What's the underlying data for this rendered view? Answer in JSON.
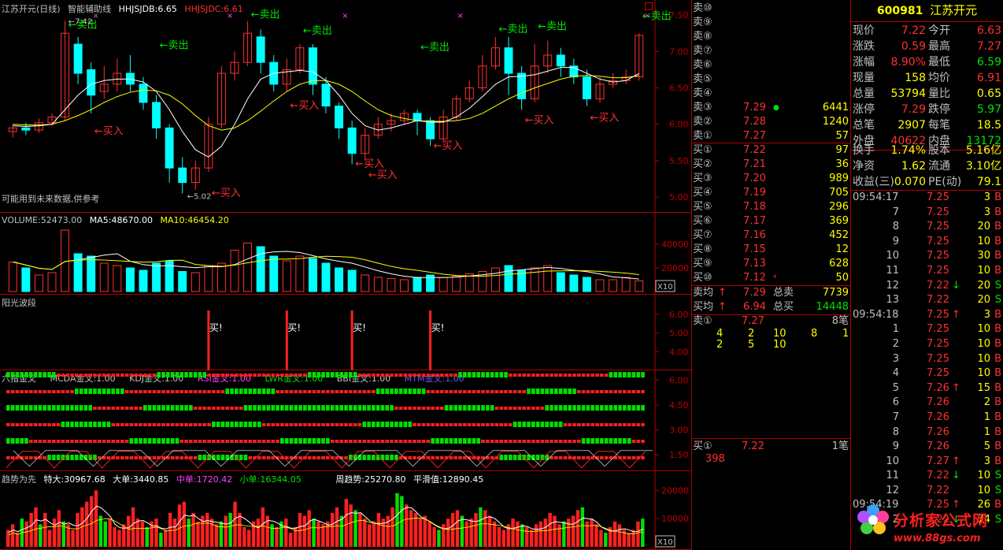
{
  "price_chart": {
    "title_name": "江苏开元(日线)",
    "title_indicator": "智能辅助线",
    "hhjsjdb_label": "HHJSJDB:6.65",
    "hhjsjdc_label": "HHJSJDC:6.61",
    "axis_labels": [
      "7.50",
      "7.00",
      "6.50",
      "6.00",
      "5.50",
      "5.00"
    ],
    "axis_values": [
      7.5,
      7.0,
      6.5,
      6.0,
      5.5,
      5.0
    ],
    "high_label": "7.42",
    "low_label": "5.02",
    "warning": "可能用到未来数据,供参考",
    "sell_label": "卖出",
    "buy_label": "买入",
    "sell_points": [
      {
        "i": 4,
        "p": 7.28
      },
      {
        "i": 11,
        "p": 7.0
      },
      {
        "i": 18,
        "p": 7.42
      },
      {
        "i": 22,
        "p": 7.2
      },
      {
        "i": 31,
        "p": 6.97
      },
      {
        "i": 37,
        "p": 7.22
      },
      {
        "i": 40,
        "p": 7.26
      },
      {
        "i": 48,
        "p": 7.4
      }
    ],
    "buy_points": [
      {
        "i": 6,
        "p": 5.95
      },
      {
        "i": 15,
        "p": 5.1
      },
      {
        "i": 21,
        "p": 6.3
      },
      {
        "i": 26,
        "p": 5.5
      },
      {
        "i": 27,
        "p": 5.35
      },
      {
        "i": 32,
        "p": 5.75
      },
      {
        "i": 39,
        "p": 6.1
      },
      {
        "i": 44,
        "p": 6.13
      }
    ],
    "candles": [
      [
        5.9,
        5.95,
        5.82,
        6.0
      ],
      [
        5.95,
        5.92,
        5.85,
        6.02
      ],
      [
        5.92,
        6.02,
        5.88,
        6.08
      ],
      [
        6.02,
        6.1,
        5.98,
        6.15
      ],
      [
        6.1,
        7.25,
        6.05,
        7.42
      ],
      [
        7.1,
        6.7,
        6.55,
        7.2
      ],
      [
        6.75,
        6.4,
        6.15,
        6.85
      ],
      [
        6.45,
        6.55,
        6.35,
        6.8
      ],
      [
        6.55,
        6.7,
        6.45,
        6.9
      ],
      [
        6.7,
        6.55,
        6.45,
        6.95
      ],
      [
        6.55,
        6.3,
        6.2,
        6.65
      ],
      [
        6.3,
        5.95,
        5.8,
        6.4
      ],
      [
        5.95,
        5.4,
        5.2,
        6.0
      ],
      [
        5.4,
        5.2,
        5.05,
        5.55
      ],
      [
        5.2,
        5.4,
        5.1,
        5.5
      ],
      [
        5.4,
        6.0,
        5.35,
        6.1
      ],
      [
        6.0,
        6.7,
        5.95,
        6.8
      ],
      [
        6.7,
        6.85,
        6.6,
        7.0
      ],
      [
        6.85,
        7.25,
        6.8,
        7.42
      ],
      [
        7.2,
        6.85,
        6.7,
        7.3
      ],
      [
        6.85,
        6.55,
        6.45,
        6.95
      ],
      [
        6.55,
        6.75,
        6.45,
        6.9
      ],
      [
        6.75,
        7.05,
        6.7,
        7.1
      ],
      [
        7.05,
        6.55,
        6.4,
        7.1
      ],
      [
        6.55,
        6.25,
        6.15,
        6.65
      ],
      [
        6.25,
        5.95,
        5.8,
        6.3
      ],
      [
        5.95,
        5.6,
        5.45,
        6.05
      ],
      [
        5.6,
        5.85,
        5.5,
        5.95
      ],
      [
        5.85,
        6.0,
        5.8,
        6.1
      ],
      [
        6.0,
        6.05,
        5.9,
        6.15
      ],
      [
        6.05,
        6.15,
        6.0,
        6.2
      ],
      [
        6.15,
        6.05,
        5.85,
        6.2
      ],
      [
        6.05,
        5.8,
        5.7,
        6.1
      ],
      [
        5.8,
        6.1,
        5.75,
        6.2
      ],
      [
        6.1,
        6.35,
        6.05,
        6.4
      ],
      [
        6.35,
        6.5,
        6.3,
        6.6
      ],
      [
        6.5,
        6.8,
        6.45,
        6.95
      ],
      [
        6.8,
        7.05,
        6.75,
        7.2
      ],
      [
        7.05,
        6.7,
        6.4,
        7.2
      ],
      [
        6.7,
        6.35,
        6.2,
        6.8
      ],
      [
        6.35,
        6.8,
        6.3,
        7.1
      ],
      [
        6.8,
        6.95,
        6.7,
        7.15
      ],
      [
        6.95,
        6.8,
        6.65,
        7.05
      ],
      [
        6.8,
        6.65,
        6.55,
        6.9
      ],
      [
        6.65,
        6.35,
        6.25,
        6.75
      ],
      [
        6.35,
        6.55,
        6.3,
        6.65
      ],
      [
        6.55,
        6.6,
        6.5,
        6.7
      ],
      [
        6.6,
        6.65,
        6.55,
        6.75
      ],
      [
        6.65,
        7.22,
        6.6,
        7.25
      ]
    ],
    "ma_short": [
      5.98,
      5.97,
      5.98,
      6.0,
      6.2,
      6.4,
      6.55,
      6.6,
      6.62,
      6.62,
      6.58,
      6.45,
      6.2,
      5.9,
      5.65,
      5.55,
      5.7,
      6.0,
      6.35,
      6.62,
      6.7,
      6.72,
      6.74,
      6.72,
      6.6,
      6.4,
      6.15,
      5.98,
      5.92,
      5.95,
      6.0,
      6.05,
      6.03,
      6.03,
      6.1,
      6.22,
      6.38,
      6.55,
      6.65,
      6.66,
      6.68,
      6.73,
      6.78,
      6.78,
      6.7,
      6.62,
      6.58,
      6.6,
      6.7
    ],
    "ma_long": [
      6.0,
      5.99,
      5.99,
      6.0,
      6.05,
      6.12,
      6.2,
      6.3,
      6.38,
      6.44,
      6.47,
      6.46,
      6.4,
      6.28,
      6.12,
      5.98,
      5.92,
      5.95,
      6.05,
      6.18,
      6.32,
      6.45,
      6.55,
      6.6,
      6.6,
      6.55,
      6.45,
      6.32,
      6.2,
      6.12,
      6.08,
      6.05,
      6.04,
      6.04,
      6.05,
      6.08,
      6.15,
      6.25,
      6.35,
      6.43,
      6.5,
      6.56,
      6.62,
      6.66,
      6.67,
      6.66,
      6.64,
      6.64,
      6.67
    ]
  },
  "volume_panel": {
    "label_volume": "VOLUME:52473.00",
    "label_ma5": "MA5:48670.00",
    "label_ma10": "MA10:46454.20",
    "axis_labels": [
      "40000",
      "20000"
    ],
    "axis_values": [
      40000,
      20000
    ],
    "max": 52000,
    "x10": "X10",
    "values": [
      25000,
      20000,
      14000,
      16000,
      52000,
      32000,
      30000,
      24000,
      22000,
      20000,
      18000,
      24000,
      26000,
      17000,
      16000,
      22000,
      24000,
      35000,
      41000,
      38000,
      30000,
      26000,
      30000,
      28000,
      24000,
      20000,
      18000,
      14000,
      12000,
      11000,
      10000,
      12000,
      14000,
      12000,
      13000,
      15000,
      17000,
      20000,
      22000,
      18000,
      20000,
      22000,
      16000,
      14000,
      12000,
      10000,
      10000,
      12000,
      9000
    ]
  },
  "signal_panel": {
    "title": "阳光波段",
    "axis_labels": [
      "6.00",
      "5.00",
      "4.00"
    ],
    "axis_values": [
      6,
      5,
      4
    ],
    "buy_text": "买!",
    "bars": [
      15,
      21,
      26,
      32
    ]
  },
  "six_finger_panel": {
    "title": "六指金叉",
    "labels": [
      "MCDA金叉:1.00",
      "KDJ金叉:1.00",
      "RSI金叉:1.00",
      "LWR金叉:1.00",
      "BBI金叉:1.00",
      "MTM金叉:1.00"
    ],
    "axis_labels": [
      "6.00",
      "4.50",
      "3.00",
      "1.50"
    ],
    "axis_values": [
      6,
      4.5,
      3,
      1.5
    ]
  },
  "trend_panel": {
    "title": "趋势为先",
    "label_super": "特大:30967.68",
    "label_large": "大单:3440.85",
    "label_mid": "中单:1720.42",
    "label_small": "小单:16344.05",
    "label_week": "周趋势:25270.80",
    "label_smooth": "平滑值:12890.45",
    "axis_labels": [
      "20000",
      "10000"
    ],
    "axis_values": [
      20000,
      10000
    ],
    "x10": "X10",
    "values": [
      6000,
      8000,
      5000,
      10000,
      9000,
      12000,
      14000,
      8000,
      12000,
      6000,
      10000,
      13000,
      9000,
      8000,
      6000,
      12000,
      14000,
      16000,
      18000,
      20000,
      11000,
      9000,
      10000,
      7000,
      6000,
      8000,
      11000,
      14000,
      10000,
      9000,
      7000,
      9000,
      10000,
      5000,
      6000,
      12000,
      10000,
      15000,
      16000,
      10000,
      12000,
      9000,
      11000,
      12000,
      10000,
      8000,
      9000,
      11000,
      12000,
      16000,
      12000,
      7000,
      6000,
      9000,
      10000,
      14000,
      11000,
      8000,
      7000,
      9000,
      10000,
      5000,
      7000,
      12000,
      11000,
      13000,
      10000,
      9000,
      8000,
      9000,
      12000,
      14000,
      11000,
      17000,
      15000,
      13000,
      12000,
      10000,
      8000,
      9000,
      12000,
      10000,
      11000,
      14000,
      19000,
      18000,
      15000,
      13000,
      12000,
      10000,
      11000,
      9000,
      7000,
      6000,
      8000,
      10000,
      12000,
      13000,
      11000,
      9000,
      10000,
      12000,
      14000,
      13000,
      11000,
      9000,
      7000,
      6000,
      8000,
      10000,
      9000,
      8000,
      7000,
      6000,
      8000,
      9000,
      10000,
      12000,
      11000,
      8000,
      9000,
      10000,
      11000,
      13000,
      14000,
      9000,
      10000,
      8000,
      6000,
      5000,
      7000,
      9000,
      8000,
      6000,
      5000,
      6000,
      9000,
      10000
    ]
  },
  "order_book": {
    "sell_labels": [
      "卖⑩",
      "卖⑨",
      "卖⑧",
      "卖⑦",
      "卖⑥",
      "卖⑤",
      "卖④",
      "卖③",
      "卖②",
      "卖①"
    ],
    "sell_levels": [
      {
        "price": "",
        "vol": ""
      },
      {
        "price": "",
        "vol": ""
      },
      {
        "price": "",
        "vol": ""
      },
      {
        "price": "",
        "vol": ""
      },
      {
        "price": "",
        "vol": ""
      },
      {
        "price": "",
        "vol": ""
      },
      {
        "price": "",
        "vol": ""
      },
      {
        "price": "7.29",
        "vol": "6441"
      },
      {
        "price": "7.28",
        "vol": "1240"
      },
      {
        "price": "7.27",
        "vol": "57"
      }
    ],
    "buy_labels": [
      "买①",
      "买②",
      "买③",
      "买④",
      "买⑤",
      "买⑥",
      "买⑦",
      "买⑧",
      "买⑨",
      "买⑩"
    ],
    "buy_levels": [
      {
        "price": "7.22",
        "vol": "97"
      },
      {
        "price": "7.21",
        "vol": "36"
      },
      {
        "price": "7.20",
        "vol": "989"
      },
      {
        "price": "7.19",
        "vol": "705"
      },
      {
        "price": "7.18",
        "vol": "296"
      },
      {
        "price": "7.17",
        "vol": "369"
      },
      {
        "price": "7.16",
        "vol": "452"
      },
      {
        "price": "7.15",
        "vol": "12"
      },
      {
        "price": "7.13",
        "vol": "628"
      },
      {
        "price": "7.12",
        "vol": "50"
      }
    ],
    "avg_sell_label": "卖均",
    "avg_sell": "7.29",
    "total_sell_label": "总卖",
    "total_sell": "7739",
    "avg_buy_label": "买均",
    "avg_buy": "6.94",
    "total_buy_label": "总买",
    "total_buy": "14448",
    "sell1_detail_label": "卖①",
    "sell1_detail_price": "7.27",
    "sell1_detail_count": "8笔",
    "sell1_queue": [
      [
        "4",
        "2",
        "10",
        "8",
        "1"
      ],
      [
        "2",
        "5",
        "10"
      ]
    ],
    "buy1_detail_label": "买①",
    "buy1_detail_price": "7.22",
    "buy1_detail_count": "1笔",
    "buy1_queue": "398"
  },
  "quote": {
    "code": "600981",
    "name": "江苏开元",
    "rows": [
      {
        "l1": "现价",
        "v1": "7.22",
        "l2": "今开",
        "v2": "6.63"
      },
      {
        "l1": "涨跌",
        "v1": "0.59",
        "l2": "最高",
        "v2": "7.27"
      },
      {
        "l1": "涨幅",
        "v1": "8.90%",
        "l2": "最低",
        "v2": "6.59"
      },
      {
        "l1": "现量",
        "v1": "158",
        "l2": "均价",
        "v2": "6.91"
      },
      {
        "l1": "总量",
        "v1": "53794",
        "l2": "量比",
        "v2": "0.65"
      },
      {
        "l1": "涨停",
        "v1": "7.29",
        "l2": "跌停",
        "v2": "5.97"
      },
      {
        "l1": "总笔",
        "v1": "2907",
        "l2": "每笔",
        "v2": "18.5"
      },
      {
        "l1": "外盘",
        "v1": "40622",
        "l2": "内盘",
        "v2": "13172"
      },
      {
        "l1": "换手",
        "v1": "1.74%",
        "l2": "股本",
        "v2": "5.16亿"
      },
      {
        "l1": "净资",
        "v1": "1.62",
        "l2": "流通",
        "v2": "3.10亿"
      },
      {
        "l1": "收益(三)",
        "v1": "0.070",
        "l2": "PE(动)",
        "v2": "79.1"
      }
    ]
  },
  "ticks": [
    {
      "t": "09:54:17",
      "p": "7.25",
      "a": "",
      "v": "3",
      "s": "B"
    },
    {
      "t": "7",
      "p": "7.25",
      "a": "",
      "v": "3",
      "s": "B"
    },
    {
      "t": "8",
      "p": "7.25",
      "a": "",
      "v": "20",
      "s": "B"
    },
    {
      "t": "9",
      "p": "7.25",
      "a": "",
      "v": "10",
      "s": "B"
    },
    {
      "t": "10",
      "p": "7.25",
      "a": "",
      "v": "30",
      "s": "B"
    },
    {
      "t": "11",
      "p": "7.25",
      "a": "",
      "v": "10",
      "s": "B"
    },
    {
      "t": "12",
      "p": "7.22",
      "a": "↓",
      "v": "20",
      "s": "S"
    },
    {
      "t": "13",
      "p": "7.22",
      "a": "",
      "v": "20",
      "s": "S"
    },
    {
      "t": "09:54:18",
      "p": "7.25",
      "a": "↑",
      "v": "3",
      "s": "B"
    },
    {
      "t": "1",
      "p": "7.25",
      "a": "",
      "v": "10",
      "s": "B"
    },
    {
      "t": "2",
      "p": "7.25",
      "a": "",
      "v": "10",
      "s": "B"
    },
    {
      "t": "3",
      "p": "7.25",
      "a": "",
      "v": "10",
      "s": "B"
    },
    {
      "t": "4",
      "p": "7.25",
      "a": "",
      "v": "10",
      "s": "B"
    },
    {
      "t": "5",
      "p": "7.26",
      "a": "↑",
      "v": "15",
      "s": "B"
    },
    {
      "t": "6",
      "p": "7.26",
      "a": "",
      "v": "2",
      "s": "B"
    },
    {
      "t": "7",
      "p": "7.26",
      "a": "",
      "v": "1",
      "s": "B"
    },
    {
      "t": "8",
      "p": "7.26",
      "a": "",
      "v": "1",
      "s": "B"
    },
    {
      "t": "9",
      "p": "7.26",
      "a": "",
      "v": "5",
      "s": "B"
    },
    {
      "t": "10",
      "p": "7.27",
      "a": "↑",
      "v": "3",
      "s": "B"
    },
    {
      "t": "11",
      "p": "7.22",
      "a": "↓",
      "v": "10",
      "s": "S"
    },
    {
      "t": "12",
      "p": "7.22",
      "a": "",
      "v": "10",
      "s": "S"
    },
    {
      "t": "09:54:19",
      "p": "7.25",
      "a": "↑",
      "v": "26",
      "s": "B"
    },
    {
      "t": "2",
      "p": "7.22",
      "a": "↓",
      "v": "74",
      "s": "S"
    }
  ],
  "watermark": {
    "site": "分析家公式网",
    "url": "www.88gs.com"
  },
  "colors": {
    "up": "#ff3030",
    "down": "#00ffff",
    "sell": "#00e000",
    "buy": "#ff3030",
    "ma_short": "#ffffff",
    "ma_long": "#ffff00",
    "bg": "#000000",
    "grid": "#b00000"
  }
}
